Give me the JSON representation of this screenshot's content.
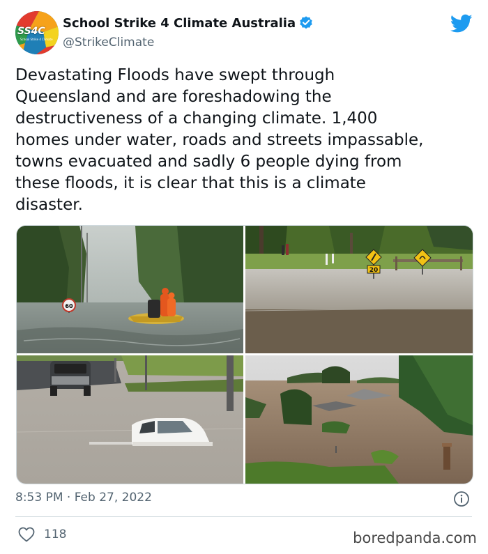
{
  "tweet": {
    "display_name": "School Strike 4 Climate Australia",
    "handle": "@StrikeClimate",
    "avatar": {
      "logo_text": "SS4C",
      "logo_subtext": "School Strike 4 Climate",
      "colors": [
        "#e23b2e",
        "#f6a21a",
        "#2f9a4b",
        "#1f7fb6",
        "#f3d31f"
      ]
    },
    "verified_icon": "verified-badge-icon",
    "verified_color": "#1d9bf0",
    "platform_icon": "twitter-bird-icon",
    "platform_color": "#1d9bf0",
    "text": "Devastating Floods have swept through\nQueensland and are foreshadowing the\ndestructiveness of a changing climate. 1,400\nhomes under water, roads and streets impassable,\ntowns evacuated and sadly 6 people dying from\nthese floods, it is clear that this is a climate\ndisaster.",
    "media": [
      {
        "name": "flood-photo-rescue-boat",
        "speed_sign": "60"
      },
      {
        "name": "flood-photo-park-signs",
        "sign": "20"
      },
      {
        "name": "flood-photo-submerged-car"
      },
      {
        "name": "flood-photo-aerial-houses"
      }
    ],
    "timestamp": "8:53 PM · Feb 27, 2022",
    "info_icon": "info-icon",
    "like_icon": "heart-icon",
    "like_count": "118"
  },
  "watermark": "boredpanda.com"
}
